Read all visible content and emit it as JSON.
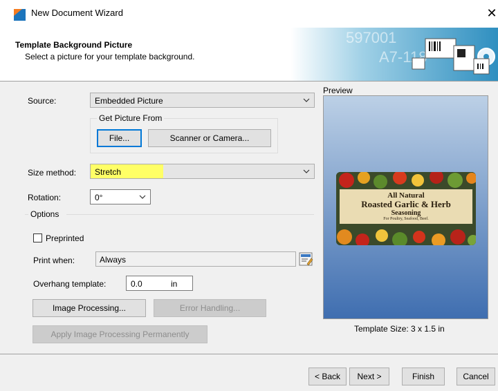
{
  "window": {
    "title": "New Document Wizard",
    "close_glyph": "✕"
  },
  "banner": {
    "title": "Template Background Picture",
    "subtitle": "Select a picture for your template background.",
    "graphic_text_1": "597001",
    "graphic_text_2": "A7-118"
  },
  "form": {
    "source_label": "Source:",
    "source_value": "Embedded Picture",
    "get_picture_from_label": "Get Picture From",
    "file_button": "File...",
    "scanner_button": "Scanner or Camera...",
    "size_method_label": "Size method:",
    "size_method_value": "Stretch",
    "rotation_label": "Rotation:",
    "rotation_value": "0°",
    "options_label": "Options",
    "preprinted_label": "Preprinted",
    "preprinted_checked": false,
    "print_when_label": "Print when:",
    "print_when_value": "Always",
    "overhang_label": "Overhang template:",
    "overhang_value": "0.0",
    "overhang_unit": "in",
    "image_processing_button": "Image Processing...",
    "error_handling_button": "Error Handling...",
    "apply_permanently_button": "Apply Image Processing Permanently"
  },
  "preview": {
    "label": "Preview",
    "line1": "All Natural",
    "line2": "Roasted Garlic & Herb",
    "line3": "Seasoning",
    "line4": "For Poultry, Seafood, Beef.",
    "template_size": "Template Size:  3 x 1.5 in"
  },
  "footer": {
    "back": "< Back",
    "next": "Next >",
    "finish": "Finish",
    "cancel": "Cancel"
  },
  "colors": {
    "highlight": "#ffff66",
    "accent": "#0078d7",
    "logo_orange": "#f57c20",
    "logo_blue": "#1c75bc"
  }
}
